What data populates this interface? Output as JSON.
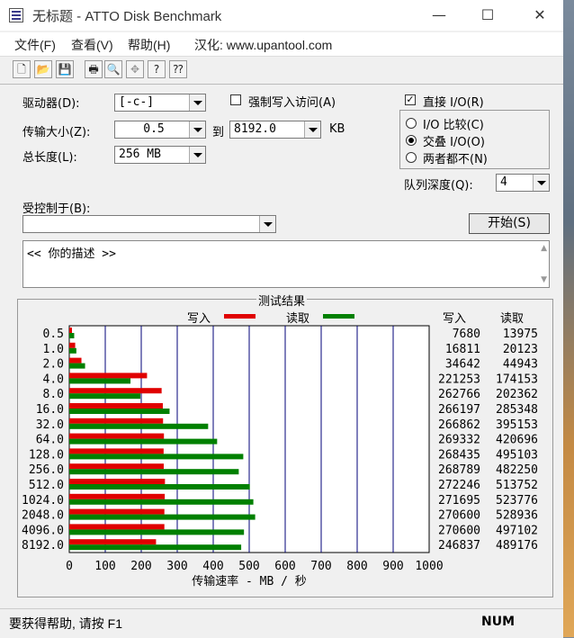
{
  "window": {
    "title": "无标题 - ATTO Disk Benchmark",
    "controls": {
      "minimize": "—",
      "maximize": "☐",
      "close": "✕"
    }
  },
  "menu": {
    "file": "文件(F)",
    "view": "查看(V)",
    "help": "帮助(H)",
    "localization": "汉化: www.upantool.com"
  },
  "toolbar": {
    "icons": [
      "new-icon",
      "open-icon",
      "save-icon",
      "print-icon",
      "print-preview-icon",
      "move-icon",
      "help-icon",
      "context-help-icon"
    ]
  },
  "settings": {
    "drive_label": "驱动器(D):",
    "drive_value": "[-c-]",
    "force_write_label": "强制写入访问(A)",
    "force_write_checked": false,
    "transfer_label": "传输大小(Z):",
    "transfer_from": "0.5",
    "to_label": "到",
    "transfer_to": "8192.0",
    "kb_label": "KB",
    "length_label": "总长度(L):",
    "length_value": "256 MB",
    "direct_io_label": "直接 I/O(R)",
    "direct_io_checked": true,
    "io_compare_label": "I/O 比较(C)",
    "overlap_io_label": "交叠 I/O(O)",
    "neither_label": "两者都不(N)",
    "selected_mode": "overlap",
    "queue_label": "队列深度(Q):",
    "queue_value": "4",
    "controlled_label": "受控制于(B):",
    "controlled_value": "",
    "start_button": "开始(S)",
    "description": "<<  你的描述  >>"
  },
  "results": {
    "title": "测试结果",
    "legend_write": "写入",
    "legend_read": "读取",
    "col_write": "写入",
    "col_read": "读取",
    "write_color": "#e00000",
    "read_color": "#008000"
  },
  "chart_data": {
    "type": "bar",
    "orientation": "horizontal",
    "categories": [
      "0.5",
      "1.0",
      "2.0",
      "4.0",
      "8.0",
      "16.0",
      "32.0",
      "64.0",
      "128.0",
      "256.0",
      "512.0",
      "1024.0",
      "2048.0",
      "4096.0",
      "8192.0"
    ],
    "series": [
      {
        "name": "写入",
        "values": [
          7680,
          16811,
          34642,
          221253,
          262766,
          266197,
          266862,
          269332,
          268435,
          268789,
          272246,
          271695,
          270600,
          270600,
          246837
        ]
      },
      {
        "name": "读取",
        "values": [
          13975,
          20123,
          44943,
          174153,
          202362,
          285348,
          395153,
          420696,
          495103,
          482250,
          513752,
          523776,
          528936,
          497102,
          489176
        ]
      }
    ],
    "xticks": [
      "0",
      "100",
      "200",
      "300",
      "400",
      "500",
      "600",
      "700",
      "800",
      "900",
      "1000"
    ],
    "xlim": [
      0,
      1000
    ],
    "xlabel": "传输速率 - MB / 秒",
    "grid": true
  },
  "statusbar": {
    "help_text": "要获得帮助, 请按 F1",
    "num_indicator": "NUM"
  }
}
